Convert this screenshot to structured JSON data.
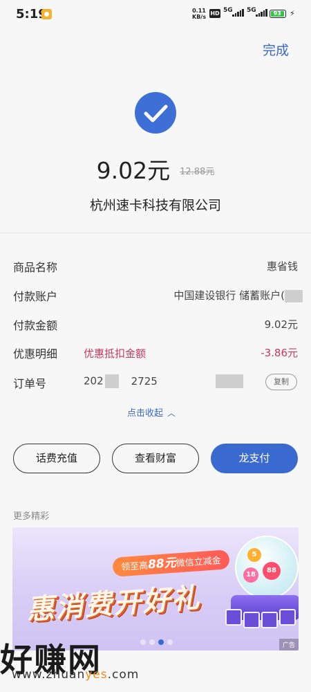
{
  "status_bar": {
    "time": "5:19",
    "net_speed_value": "0.11",
    "net_speed_unit": "KB/s",
    "hd_label": "HD",
    "network_1": "5G",
    "network_2": "5G",
    "battery": "93"
  },
  "header": {
    "done_label": "完成"
  },
  "payment": {
    "amount": "9.02元",
    "original_amount": "12.88元",
    "merchant": "杭州速卡科技有限公司"
  },
  "details": {
    "product_label": "商品名称",
    "product_value": "惠省钱",
    "account_label": "付款账户",
    "account_value": "中国建设银行 储蓄账户(",
    "paid_label": "付款金额",
    "paid_value": "9.02元",
    "discount_label": "优惠明细",
    "discount_name": "优惠抵扣金额",
    "discount_value": "-3.86元",
    "order_label": "订单号",
    "order_prefix": "202",
    "order_mid": "2725",
    "copy_label": "复制",
    "collapse_label": "点击收起"
  },
  "actions": {
    "topup_label": "话费充值",
    "wealth_label": "查看财富",
    "longpay_label": "龙支付"
  },
  "more": {
    "title": "更多精彩",
    "banner_pill_prefix": "领至高",
    "banner_pill_amount": "88元",
    "banner_pill_suffix": "微信立减金",
    "banner_title": "惠消费开好礼",
    "ad_tag": "广告",
    "ball_1": "5",
    "ball_2": "18",
    "ball_3": "88"
  },
  "watermark": {
    "title": "好赚网",
    "url_prefix": "www.zhuan",
    "url_highlight": "yes",
    "url_suffix": ".com"
  },
  "colors": {
    "accent": "#3a6ad0",
    "discount_red": "#c53a5b",
    "success": "#3d6fd6"
  }
}
